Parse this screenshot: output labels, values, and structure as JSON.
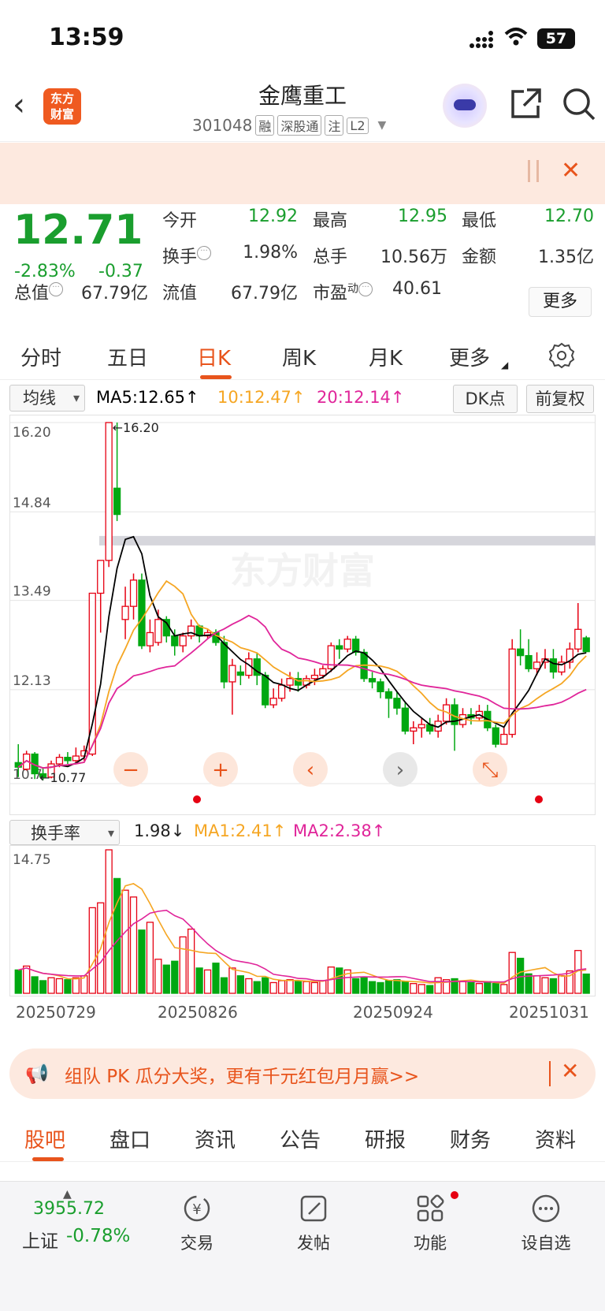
{
  "status_bar": {
    "time": "13:59",
    "battery": "57"
  },
  "header": {
    "logo_text": "东方财富",
    "stock_name": "金鹰重工",
    "stock_code": "301048",
    "tags": [
      "融",
      "深股通",
      "注",
      "L2"
    ]
  },
  "quote": {
    "price": "12.71",
    "change_pct": "-2.83%",
    "change_amt": "-0.37",
    "open_label": "今开",
    "open": "12.92",
    "high_label": "最高",
    "high": "12.95",
    "low_label": "最低",
    "low": "12.70",
    "turnover_label": "换手",
    "turnover": "1.98%",
    "volume_label": "总手",
    "volume": "10.56万",
    "amount_label": "金额",
    "amount": "1.35亿",
    "mktcap_label": "总值",
    "mktcap": "67.79亿",
    "float_label": "流值",
    "float_cap": "67.79亿",
    "pe_label": "市盈",
    "pe_sup": "动",
    "pe": "40.61",
    "more_label": "更多"
  },
  "kline_tabs": [
    "分时",
    "五日",
    "日K",
    "周K",
    "月K",
    "更多"
  ],
  "ma_bar": {
    "selector": "均线",
    "ma5": "MA5:12.65",
    "ma10": "10:12.47",
    "ma20": "20:12.14",
    "dk_label": "DK点",
    "adjust_label": "前复权"
  },
  "colors": {
    "up": "#e60012",
    "down": "#00a811",
    "accent": "#e8541c",
    "ma5": "#000000",
    "ma10": "#f5a623",
    "ma20": "#e0259a"
  },
  "chart_data": {
    "type": "candlestick",
    "ylim": [
      10.7,
      16.2
    ],
    "y_ticks": [
      "16.20",
      "14.84",
      "13.49",
      "12.13",
      "10.7"
    ],
    "annotations": {
      "max": "16.20",
      "min": "10.77"
    },
    "candles": [
      [
        11.02,
        10.95,
        11.3,
        10.8
      ],
      [
        10.92,
        11.15,
        11.2,
        10.9
      ],
      [
        11.15,
        10.85,
        11.18,
        10.77
      ],
      [
        10.85,
        10.8,
        10.95,
        10.75
      ],
      [
        10.8,
        11.0,
        11.05,
        10.78
      ],
      [
        11.0,
        11.1,
        11.15,
        10.95
      ],
      [
        11.1,
        11.05,
        11.18,
        11.0
      ],
      [
        11.05,
        11.12,
        11.25,
        11.0
      ],
      [
        11.12,
        11.2,
        11.28,
        11.05
      ],
      [
        11.15,
        13.6,
        13.6,
        11.12
      ],
      [
        13.6,
        14.1,
        14.1,
        13.0
      ],
      [
        14.1,
        16.2,
        16.2,
        14.0
      ],
      [
        15.2,
        14.8,
        16.2,
        14.7
      ],
      [
        13.2,
        13.4,
        13.7,
        12.9
      ],
      [
        13.4,
        13.8,
        13.9,
        13.2
      ],
      [
        13.8,
        12.8,
        13.9,
        12.75
      ],
      [
        12.8,
        13.0,
        13.2,
        12.7
      ],
      [
        12.85,
        13.2,
        13.35,
        12.8
      ],
      [
        13.2,
        12.95,
        13.25,
        12.85
      ],
      [
        12.95,
        12.8,
        13.05,
        12.65
      ],
      [
        12.8,
        12.95,
        13.0,
        12.7
      ],
      [
        12.95,
        13.1,
        13.2,
        12.9
      ],
      [
        13.1,
        12.95,
        13.12,
        12.85
      ],
      [
        12.95,
        13.0,
        13.05,
        12.9
      ],
      [
        13.0,
        12.85,
        13.05,
        12.8
      ],
      [
        12.85,
        12.25,
        12.95,
        12.15
      ],
      [
        12.25,
        12.5,
        12.6,
        11.75
      ],
      [
        12.4,
        12.35,
        12.5,
        12.2
      ],
      [
        12.35,
        12.6,
        12.7,
        12.3
      ],
      [
        12.6,
        12.35,
        12.7,
        12.2
      ],
      [
        12.35,
        11.9,
        12.4,
        11.85
      ],
      [
        11.9,
        12.0,
        12.15,
        11.85
      ],
      [
        12.0,
        12.2,
        12.3,
        11.95
      ],
      [
        12.2,
        12.3,
        12.4,
        12.1
      ],
      [
        12.3,
        12.2,
        12.4,
        12.1
      ],
      [
        12.2,
        12.3,
        12.35,
        12.15
      ],
      [
        12.3,
        12.35,
        12.45,
        12.2
      ],
      [
        12.35,
        12.45,
        12.5,
        12.3
      ],
      [
        12.45,
        12.8,
        12.85,
        12.4
      ],
      [
        12.8,
        12.75,
        12.9,
        12.6
      ],
      [
        12.75,
        12.9,
        12.95,
        12.7
      ],
      [
        12.9,
        12.7,
        12.95,
        12.65
      ],
      [
        12.7,
        12.3,
        12.75,
        12.25
      ],
      [
        12.3,
        12.25,
        12.4,
        12.15
      ],
      [
        12.25,
        12.1,
        12.3,
        12.0
      ],
      [
        12.1,
        12.0,
        12.15,
        11.7
      ],
      [
        12.0,
        11.85,
        12.1,
        11.75
      ],
      [
        11.85,
        11.5,
        11.95,
        11.45
      ],
      [
        11.5,
        11.55,
        11.65,
        11.3
      ],
      [
        11.55,
        11.6,
        11.7,
        11.4
      ],
      [
        11.6,
        11.5,
        11.7,
        11.45
      ],
      [
        11.5,
        11.65,
        11.75,
        11.4
      ],
      [
        11.65,
        11.9,
        12.0,
        11.6
      ],
      [
        11.9,
        11.6,
        12.0,
        11.2
      ],
      [
        11.6,
        11.75,
        11.85,
        11.55
      ],
      [
        11.75,
        11.7,
        11.85,
        11.6
      ],
      [
        11.7,
        11.8,
        11.9,
        11.65
      ],
      [
        11.8,
        11.55,
        11.9,
        11.5
      ],
      [
        11.55,
        11.3,
        11.6,
        11.25
      ],
      [
        11.3,
        11.45,
        11.55,
        11.3
      ],
      [
        11.45,
        12.75,
        12.9,
        11.4
      ],
      [
        12.75,
        12.65,
        13.05,
        12.5
      ],
      [
        12.65,
        12.45,
        12.9,
        12.4
      ],
      [
        12.45,
        12.55,
        12.7,
        12.35
      ],
      [
        12.55,
        12.6,
        12.75,
        12.45
      ],
      [
        12.6,
        12.4,
        12.75,
        12.3
      ],
      [
        12.4,
        12.55,
        12.65,
        12.35
      ],
      [
        12.55,
        12.75,
        12.85,
        12.45
      ],
      [
        12.75,
        13.05,
        13.45,
        12.7
      ],
      [
        12.92,
        12.71,
        12.95,
        12.7
      ]
    ],
    "ma5_label": "MA5",
    "ma10_label": "MA10",
    "ma20_label": "MA20",
    "turnover": {
      "ylim": [
        0,
        14.75
      ],
      "y_tick": "14.75",
      "values": [
        2.4,
        2.8,
        1.7,
        1.3,
        1.6,
        1.5,
        1.4,
        1.6,
        1.8,
        8.8,
        9.3,
        14.75,
        11.8,
        10.6,
        9.9,
        6.5,
        7.3,
        3.5,
        2.9,
        3.3,
        5.8,
        6.6,
        2.6,
        2.4,
        3.1,
        1.6,
        2.6,
        1.8,
        1.5,
        1.2,
        1.6,
        1.1,
        1.3,
        1.4,
        1.2,
        1.2,
        1.1,
        1.3,
        2.7,
        2.6,
        2.4,
        1.5,
        1.6,
        1.2,
        1.1,
        1.3,
        1.4,
        1.2,
        1.0,
        0.9,
        0.8,
        1.6,
        1.4,
        1.5,
        1.2,
        1.1,
        1.0,
        1.2,
        1.0,
        0.9,
        4.2,
        3.6,
        2.0,
        1.8,
        1.6,
        1.5,
        1.8,
        2.3,
        4.4,
        1.98
      ],
      "x_labels": [
        "20250729",
        "20250826",
        "20250924",
        "20251031"
      ]
    }
  },
  "turnover_bar": {
    "selector": "换手率",
    "value": "1.98",
    "ma1": "MA1:2.41",
    "ma2": "MA2:2.38"
  },
  "promo": {
    "text": "组队 PK 瓜分大奖，更有千元红包月月赢>>"
  },
  "sub_tabs": [
    "股吧",
    "盘口",
    "资讯",
    "公告",
    "研报",
    "财务",
    "资料"
  ],
  "bottom_nav": {
    "index_value": "3955.72",
    "index_name": "上证",
    "index_change": "-0.78%",
    "items": [
      "交易",
      "发帖",
      "功能",
      "设自选"
    ]
  }
}
